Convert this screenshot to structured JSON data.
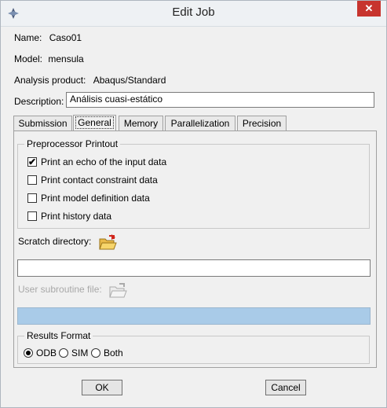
{
  "window": {
    "title": "Edit Job",
    "close_symbol": "✕"
  },
  "job": {
    "name_label": "Name:",
    "name_value": "Caso01",
    "model_label": "Model:",
    "model_value": "mensula",
    "analysis_label": "Analysis product:",
    "analysis_value": "Abaqus/Standard",
    "description_label": "Description:",
    "description_value": "Análisis cuasi-estático"
  },
  "tabs": [
    {
      "label": "Submission",
      "active": false
    },
    {
      "label": "General",
      "active": true
    },
    {
      "label": "Memory",
      "active": false
    },
    {
      "label": "Parallelization",
      "active": false
    },
    {
      "label": "Precision",
      "active": false
    }
  ],
  "preprocessor": {
    "title": "Preprocessor Printout",
    "options": [
      {
        "label": "Print an echo of the input data",
        "checked": true
      },
      {
        "label": "Print contact constraint data",
        "checked": false
      },
      {
        "label": "Print model definition data",
        "checked": false
      },
      {
        "label": "Print history data",
        "checked": false
      }
    ]
  },
  "scratch": {
    "label": "Scratch directory:",
    "value": ""
  },
  "user_subroutine": {
    "label": "User subroutine file:",
    "value": ""
  },
  "results_format": {
    "title": "Results Format",
    "options": [
      {
        "label": "ODB",
        "selected": true
      },
      {
        "label": "SIM",
        "selected": false
      },
      {
        "label": "Both",
        "selected": false
      }
    ]
  },
  "buttons": {
    "ok": "OK",
    "cancel": "Cancel"
  },
  "check_mark": "✔",
  "colors": {
    "close": "#c7342e",
    "selection": "#a9cbe8"
  },
  "icons": [
    "app-icon",
    "close-icon",
    "folder-open-icon"
  ]
}
